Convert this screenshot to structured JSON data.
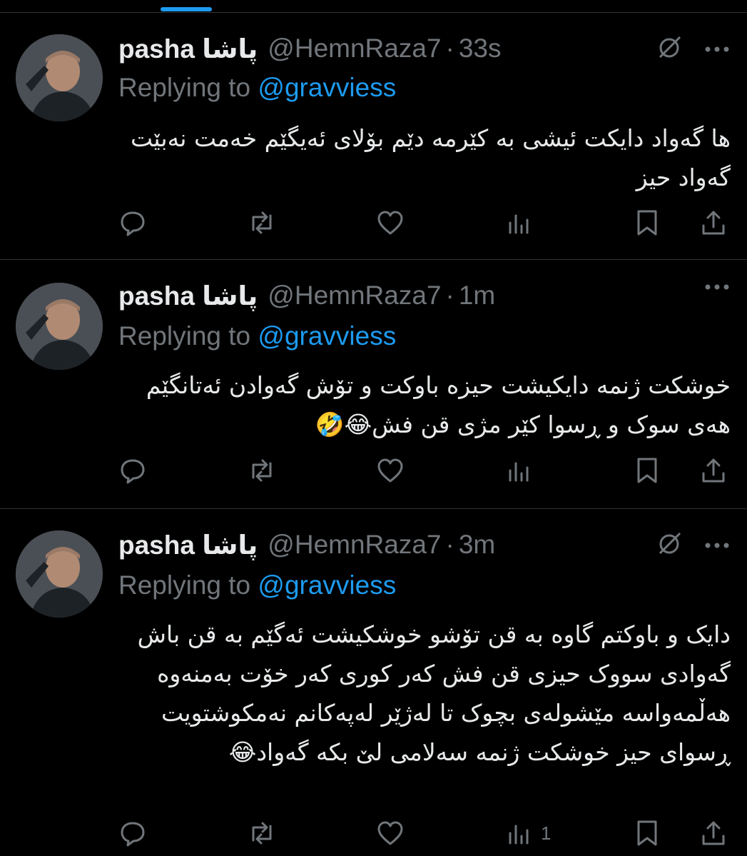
{
  "tweets": [
    {
      "name": "pasha پاشا",
      "handle": "@HemnRaza7",
      "time": "33s",
      "replying_prefix": "Replying to",
      "replying_to": "@gravviess",
      "text": "ها گەواد دایکت ئیشی بە کێرمە دێم بۆلای ئەیگێم خەمت نەبێت گەواد حیز",
      "views": ""
    },
    {
      "name": "pasha پاشا",
      "handle": "@HemnRaza7",
      "time": "1m",
      "replying_prefix": "Replying to",
      "replying_to": "@gravviess",
      "text": "خوشکت ژنمە دایکیشت حیزە باوکت و تۆش گەوادن ئەتانگێم هەی سوک و ڕسوا کێر مژی قن فش😂🤣",
      "views": ""
    },
    {
      "name": "pasha پاشا",
      "handle": "@HemnRaza7",
      "time": "3m",
      "replying_prefix": "Replying to",
      "replying_to": "@gravviess",
      "text": "دایک و باوکتم گاوە بە قن تۆشو خوشکیشت ئەگێم بە قن باش گەوادی سووک حیزی قن فش کەر کوری کەر خۆت بەمنەوە هەڵمەواسە مێشولەی بچوک تا لەژێر لەپەکانم نەمکوشتویت ڕسوای حیز خوشکت ژنمە سەلامی لێ بکە گەواد😂",
      "views": "1"
    }
  ],
  "icons": {
    "more": "more-icon",
    "grok": "grok-icon",
    "reply": "reply-icon",
    "retweet": "retweet-icon",
    "like": "like-icon",
    "views": "views-icon",
    "bookmark": "bookmark-icon",
    "share": "share-icon"
  },
  "colors": {
    "background": "#000000",
    "text": "#e7e9ea",
    "secondary": "#71767b",
    "accent": "#1d9bf0",
    "divider": "#2f3336"
  }
}
